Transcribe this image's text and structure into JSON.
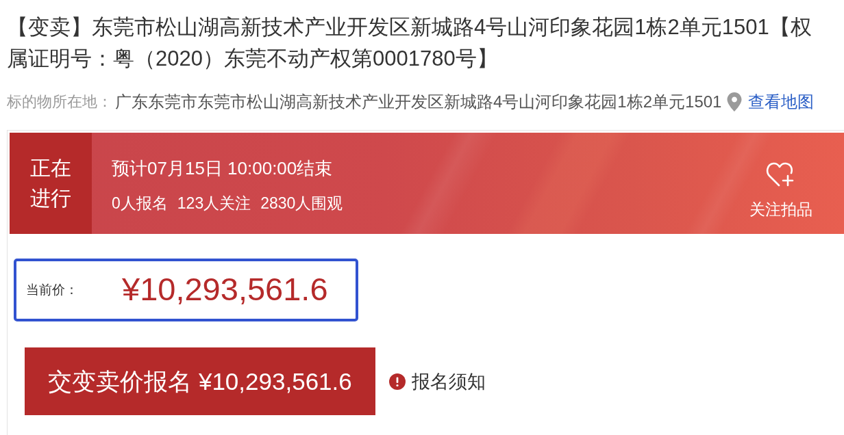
{
  "title": "【变卖】东莞市松山湖高新技术产业开发区新城路4号山河印象花园1栋2单元1501【权属证明号：粤（2020）东莞不动产权第0001780号】",
  "location": {
    "label": "标的物所在地：",
    "address": "广东东莞市东莞市松山湖高新技术产业开发区新城路4号山河印象花园1栋2单元1501",
    "map_link": "查看地图"
  },
  "auction": {
    "status": "正在进行",
    "end_time": "预计07月15日 10:00:00结束",
    "stats": [
      "0人报名",
      "123人关注",
      "2830人围观"
    ],
    "follow_button": "关注拍品"
  },
  "price": {
    "label": "当前价：",
    "value": "¥10,293,561.6"
  },
  "register_button": "交变卖价报名 ¥10,293,561.6",
  "notice_link": "报名须知"
}
